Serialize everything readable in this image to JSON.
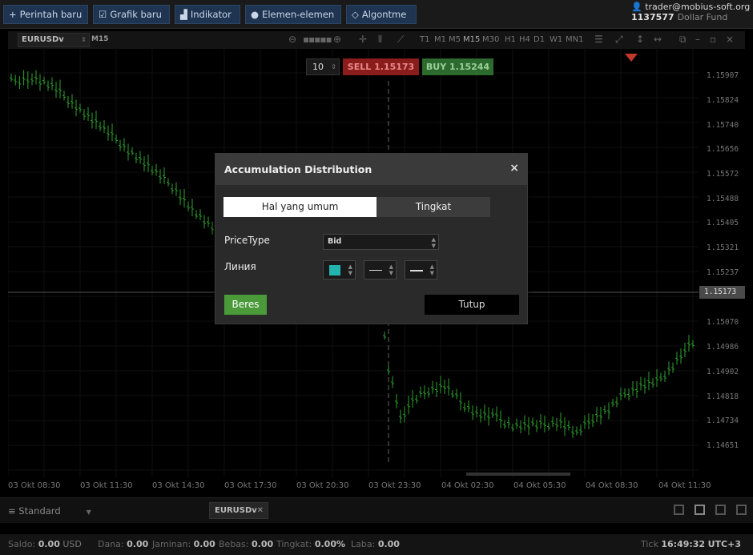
{
  "toolbar": {
    "new_order": "Perintah baru",
    "new_chart": "Grafik baru",
    "indicator": "Indikator",
    "elements": "Elemen-elemen",
    "algo": "Algontme"
  },
  "account": {
    "user": "trader@mobius-soft.org",
    "number": "1137577",
    "fund": "Dollar Fund"
  },
  "chart_header": {
    "symbol": "EURUSDv",
    "timeframe_label": "M15",
    "timeframes": [
      "T1",
      "M1",
      "M5",
      "M15",
      "M30",
      "H1",
      "H4",
      "D1",
      "W1",
      "MN1"
    ],
    "active_timeframe": "M15"
  },
  "trade": {
    "quantity": "10",
    "sell_label": "SELL 1.15173",
    "buy_label": "BUY 1.15244",
    "colors": {
      "sell_bg": "#8a1c1c",
      "buy_bg": "#2d6a2d"
    }
  },
  "chart": {
    "price_ticks": [
      "1.15907",
      "1.15824",
      "1.15740",
      "1.15656",
      "1.15572",
      "1.15488",
      "1.15405",
      "1.15321",
      "1.15237",
      "1.15070",
      "1.14986",
      "1.14902",
      "1.14818",
      "1.14734",
      "1.14651"
    ],
    "current_price": "1.15173",
    "time_ticks": [
      "03 Okt 08:30",
      "03 Okt 11:30",
      "03 Okt 14:30",
      "03 Okt 17:30",
      "03 Okt 20:30",
      "03 Okt 23:30",
      "04 Okt 02:30",
      "04 Okt 05:30",
      "04 Okt 08:30",
      "04 Okt 11:30"
    ],
    "candle_color": "#2ea02e"
  },
  "modal": {
    "title": "Accumulation Distribution",
    "close_glyph": "×",
    "tab_general": "Hal yang umum",
    "tab_level": "Tingkat",
    "price_type_label": "PriceType",
    "price_type_value": "Bid",
    "line_label": "Линия",
    "line_color": "#22b5b0",
    "ok_label": "Beres",
    "close_label": "Tutup"
  },
  "bottom": {
    "workspace": "Standard",
    "symbol_tab": "EURUSDv"
  },
  "status": {
    "saldo_label": "Saldo:",
    "saldo_value": "0.00",
    "currency": "USD",
    "dana_label": "Dana:",
    "dana_value": "0.00",
    "jaminan_label": "Jaminan:",
    "jaminan_value": "0.00",
    "bebas_label": "Bebas:",
    "bebas_value": "0.00",
    "tingkat_label": "Tingkat:",
    "tingkat_value": "0.00%",
    "laba_label": "Laba:",
    "laba_value": "0.00",
    "tick_label": "Tick",
    "time": "16:49:32",
    "timezone": "UTC+3"
  }
}
